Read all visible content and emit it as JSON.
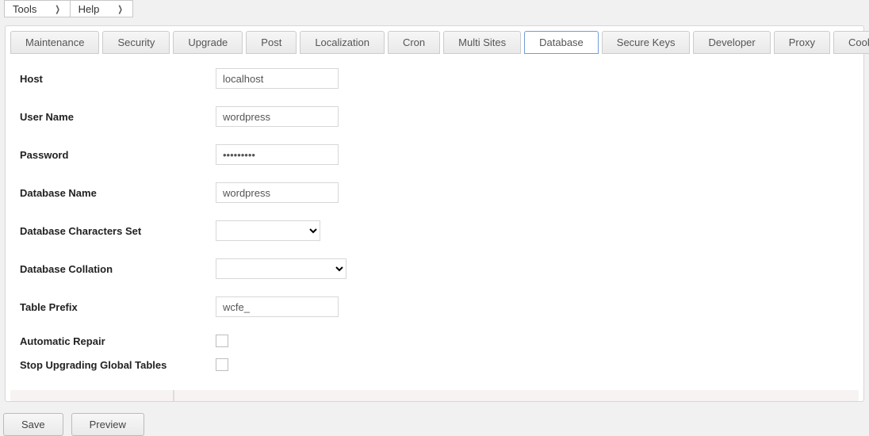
{
  "menubar": {
    "items": [
      "Tools",
      "Help"
    ]
  },
  "tabs": [
    "Maintenance",
    "Security",
    "Upgrade",
    "Post",
    "Localization",
    "Cron",
    "Multi Sites",
    "Database",
    "Secure Keys",
    "Developer",
    "Proxy",
    "Cookies"
  ],
  "active_tab": "Database",
  "form": {
    "host": {
      "label": "Host",
      "value": "localhost"
    },
    "username": {
      "label": "User Name",
      "value": "wordpress"
    },
    "password": {
      "label": "Password",
      "value": "•••••••••"
    },
    "dbname": {
      "label": "Database Name",
      "value": "wordpress"
    },
    "charset": {
      "label": "Database Characters Set",
      "value": ""
    },
    "collation": {
      "label": "Database Collation",
      "value": ""
    },
    "prefix": {
      "label": "Table Prefix",
      "value": "wcfe_"
    },
    "auto_repair": {
      "label": "Automatic Repair",
      "checked": false
    },
    "stop_upgrade_global": {
      "label": "Stop Upgrading Global Tables",
      "checked": false
    }
  },
  "actions": {
    "save": "Save",
    "preview": "Preview"
  }
}
